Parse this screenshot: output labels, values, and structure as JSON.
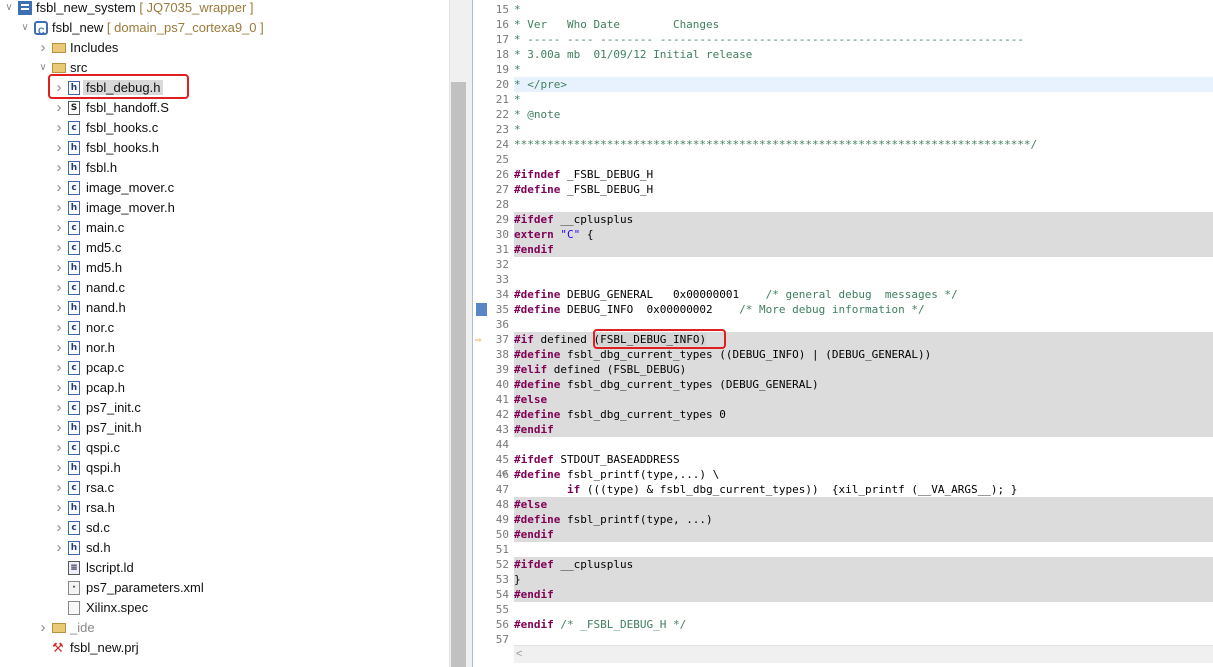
{
  "explorer": {
    "system_project": {
      "name": "fsbl_new_system",
      "decoration": "[ JQ7035_wrapper ]"
    },
    "app_project": {
      "name": "fsbl_new",
      "decoration": "[ domain_ps7_cortexa9_0 ]"
    },
    "includes_label": "Includes",
    "src_label": "src",
    "files": [
      {
        "name": "fsbl_debug.h",
        "type": "h",
        "selected": true
      },
      {
        "name": "fsbl_handoff.S",
        "type": "s"
      },
      {
        "name": "fsbl_hooks.c",
        "type": "c"
      },
      {
        "name": "fsbl_hooks.h",
        "type": "h"
      },
      {
        "name": "fsbl.h",
        "type": "h"
      },
      {
        "name": "image_mover.c",
        "type": "c"
      },
      {
        "name": "image_mover.h",
        "type": "h"
      },
      {
        "name": "main.c",
        "type": "c"
      },
      {
        "name": "md5.c",
        "type": "c"
      },
      {
        "name": "md5.h",
        "type": "h"
      },
      {
        "name": "nand.c",
        "type": "c"
      },
      {
        "name": "nand.h",
        "type": "h"
      },
      {
        "name": "nor.c",
        "type": "c"
      },
      {
        "name": "nor.h",
        "type": "h"
      },
      {
        "name": "pcap.c",
        "type": "c"
      },
      {
        "name": "pcap.h",
        "type": "h"
      },
      {
        "name": "ps7_init.c",
        "type": "c"
      },
      {
        "name": "ps7_init.h",
        "type": "h"
      },
      {
        "name": "qspi.c",
        "type": "c"
      },
      {
        "name": "qspi.h",
        "type": "h"
      },
      {
        "name": "rsa.c",
        "type": "c"
      },
      {
        "name": "rsa.h",
        "type": "h"
      },
      {
        "name": "sd.c",
        "type": "c"
      },
      {
        "name": "sd.h",
        "type": "h"
      }
    ],
    "other_files": [
      {
        "name": "lscript.ld",
        "type": "ld"
      },
      {
        "name": "ps7_parameters.xml",
        "type": "xml"
      },
      {
        "name": "Xilinx.spec",
        "type": "spec"
      }
    ],
    "ide_folder": "_ide",
    "prj_file": "fsbl_new.prj"
  },
  "editor": {
    "lines": [
      {
        "n": 15,
        "tokens": [
          [
            "cm",
            "*"
          ]
        ]
      },
      {
        "n": 16,
        "tokens": [
          [
            "cm",
            "* Ver   Who Date        Changes"
          ]
        ]
      },
      {
        "n": 17,
        "tokens": [
          [
            "cm",
            "* ----- ---- -------- -------------------------------------------------------"
          ]
        ]
      },
      {
        "n": 18,
        "tokens": [
          [
            "cm",
            "* 3.00a mb  01/09/12 Initial release"
          ]
        ]
      },
      {
        "n": 19,
        "tokens": [
          [
            "cm",
            "*"
          ]
        ]
      },
      {
        "n": 20,
        "tokens": [
          [
            "cm",
            "* </pre>"
          ]
        ],
        "current": true
      },
      {
        "n": 21,
        "tokens": [
          [
            "cm",
            "*"
          ]
        ]
      },
      {
        "n": 22,
        "tokens": [
          [
            "cm",
            "* @note"
          ]
        ]
      },
      {
        "n": 23,
        "tokens": [
          [
            "cm",
            "*"
          ]
        ]
      },
      {
        "n": 24,
        "tokens": [
          [
            "cm",
            "******************************************************************************/"
          ]
        ]
      },
      {
        "n": 25,
        "tokens": []
      },
      {
        "n": 26,
        "tokens": [
          [
            "pp",
            "#ifndef"
          ],
          [
            "tx",
            " _FSBL_DEBUG_H"
          ]
        ]
      },
      {
        "n": 27,
        "tokens": [
          [
            "pp",
            "#define"
          ],
          [
            "tx",
            " _FSBL_DEBUG_H"
          ]
        ]
      },
      {
        "n": 28,
        "tokens": []
      },
      {
        "n": 29,
        "tokens": [
          [
            "pp",
            "#ifdef"
          ],
          [
            "tx",
            " __cplusplus"
          ]
        ],
        "inactive": true
      },
      {
        "n": 30,
        "tokens": [
          [
            "kw",
            "extern"
          ],
          [
            "tx",
            " "
          ],
          [
            "str",
            "\"C\""
          ],
          [
            "tx",
            " {"
          ]
        ],
        "inactive": true
      },
      {
        "n": 31,
        "tokens": [
          [
            "pp",
            "#endif"
          ]
        ],
        "inactive": true
      },
      {
        "n": 32,
        "tokens": []
      },
      {
        "n": 33,
        "tokens": []
      },
      {
        "n": 34,
        "tokens": [
          [
            "pp",
            "#define"
          ],
          [
            "tx",
            " DEBUG_GENERAL   0x00000001    "
          ],
          [
            "cm",
            "/* general debug  messages */"
          ]
        ]
      },
      {
        "n": 35,
        "tokens": [
          [
            "pp",
            "#define"
          ],
          [
            "tx",
            " DEBUG_INFO  0x00000002    "
          ],
          [
            "cm",
            "/* More debug information */"
          ]
        ],
        "marker": "block"
      },
      {
        "n": 36,
        "tokens": []
      },
      {
        "n": 37,
        "tokens": [
          [
            "pp",
            "#if"
          ],
          [
            "tx",
            " defined "
          ],
          [
            "mac",
            "(FSBL_DEBUG_INFO)"
          ]
        ],
        "inactive": true,
        "marker": "arrow"
      },
      {
        "n": 38,
        "tokens": [
          [
            "pp",
            "#define"
          ],
          [
            "tx",
            " fsbl_dbg_current_types ((DEBUG_INFO) | (DEBUG_GENERAL))"
          ]
        ],
        "inactive": true
      },
      {
        "n": 39,
        "tokens": [
          [
            "pp",
            "#elif"
          ],
          [
            "tx",
            " defined (FSBL_DEBUG)"
          ]
        ],
        "inactive": true
      },
      {
        "n": 40,
        "tokens": [
          [
            "pp",
            "#define"
          ],
          [
            "tx",
            " fsbl_dbg_current_types (DEBUG_GENERAL)"
          ]
        ],
        "inactive": true
      },
      {
        "n": 41,
        "tokens": [
          [
            "pp",
            "#else"
          ]
        ],
        "inactive": true
      },
      {
        "n": 42,
        "tokens": [
          [
            "pp",
            "#define"
          ],
          [
            "tx",
            " fsbl_dbg_current_types 0"
          ]
        ],
        "inactive": true
      },
      {
        "n": 43,
        "tokens": [
          [
            "pp",
            "#endif"
          ]
        ],
        "inactive": true
      },
      {
        "n": 44,
        "tokens": []
      },
      {
        "n": 45,
        "tokens": [
          [
            "pp",
            "#ifdef"
          ],
          [
            "tx",
            " STDOUT_BASEADDRESS"
          ]
        ]
      },
      {
        "n": 46,
        "tokens": [
          [
            "pp",
            "#define"
          ],
          [
            "tx",
            " fsbl_printf(type,...) \\"
          ]
        ],
        "fold": true
      },
      {
        "n": 47,
        "tokens": [
          [
            "tx",
            "        "
          ],
          [
            "kw",
            "if"
          ],
          [
            "tx",
            " (((type) & fsbl_dbg_current_types))  {xil_printf (__VA_ARGS__); }"
          ]
        ]
      },
      {
        "n": 48,
        "tokens": [
          [
            "pp",
            "#else"
          ]
        ],
        "inactive": true
      },
      {
        "n": 49,
        "tokens": [
          [
            "pp",
            "#define"
          ],
          [
            "tx",
            " fsbl_printf(type, ...)"
          ]
        ],
        "inactive": true
      },
      {
        "n": 50,
        "tokens": [
          [
            "pp",
            "#endif"
          ]
        ],
        "inactive": true
      },
      {
        "n": 51,
        "tokens": []
      },
      {
        "n": 52,
        "tokens": [
          [
            "pp",
            "#ifdef"
          ],
          [
            "tx",
            " __cplusplus"
          ]
        ],
        "inactive": true
      },
      {
        "n": 53,
        "tokens": [
          [
            "tx",
            "}"
          ]
        ],
        "inactive": true
      },
      {
        "n": 54,
        "tokens": [
          [
            "pp",
            "#endif"
          ]
        ],
        "inactive": true
      },
      {
        "n": 55,
        "tokens": []
      },
      {
        "n": 56,
        "tokens": [
          [
            "pp",
            "#endif"
          ],
          [
            "tx",
            " "
          ],
          [
            "cm",
            "/* _FSBL_DEBUG_H */"
          ]
        ]
      },
      {
        "n": 57,
        "tokens": []
      }
    ]
  }
}
